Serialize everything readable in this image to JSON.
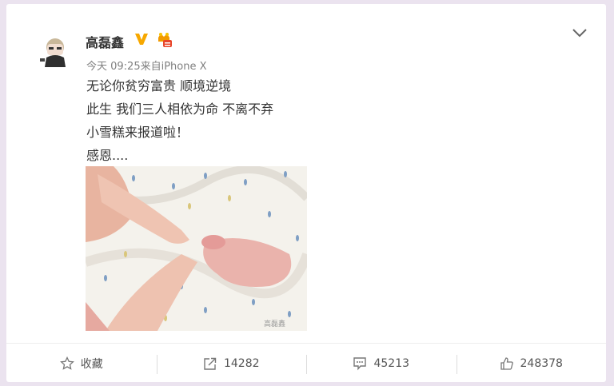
{
  "post": {
    "author": "高磊鑫",
    "meta": "今天 09:25来自iPhone X",
    "lines": [
      "无论你贫穷富贵 顺境逆境",
      "此生 我们三人相依为命 不离不弃",
      "小雪糕来报道啦！",
      "感恩...."
    ],
    "image_watermark": "高磊鑫"
  },
  "actions": {
    "favorite": "收藏",
    "repost": "14282",
    "comment": "45213",
    "like": "248378"
  },
  "colors": {
    "accent": "#f7a800",
    "text": "#333333",
    "muted": "#808080"
  }
}
